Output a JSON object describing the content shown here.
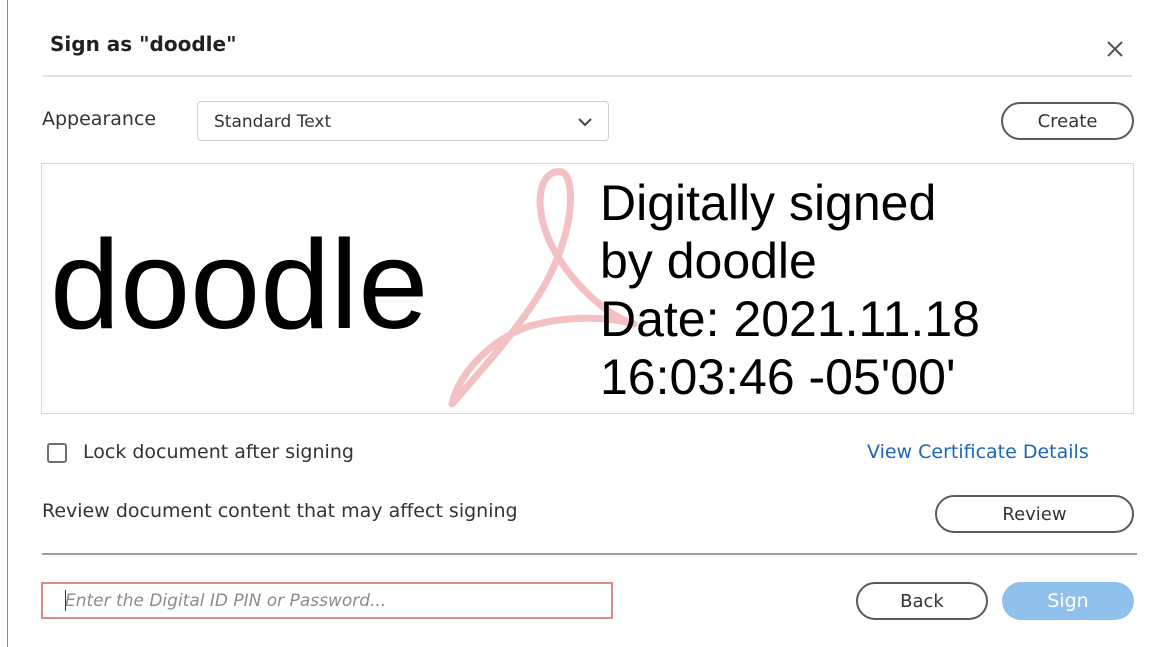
{
  "dialog": {
    "title": "Sign as \"doodle\"",
    "close_icon": "close-icon"
  },
  "appearance": {
    "label": "Appearance",
    "selected": "Standard Text",
    "chevron_icon": "chevron-down-icon",
    "create_label": "Create"
  },
  "preview": {
    "name": "doodle",
    "detail_lines": [
      "Digitally signed",
      "by doodle",
      "Date: 2021.11.18",
      "16:03:46 -05'00'"
    ],
    "watermark_icon": "adobe-acrobat-logo",
    "watermark_color": "#f3c1c4"
  },
  "options": {
    "lock_label": "Lock document after signing",
    "lock_checked": false,
    "cert_link": "View Certificate Details",
    "review_text": "Review document content that may affect signing",
    "review_label": "Review"
  },
  "footer": {
    "pin_placeholder": "Enter the Digital ID PIN or Password...",
    "pin_value": "",
    "back_label": "Back",
    "sign_label": "Sign"
  },
  "colors": {
    "link": "#1b67b5",
    "sign_button": "#90c0ec",
    "input_border": "#d98b8b"
  }
}
